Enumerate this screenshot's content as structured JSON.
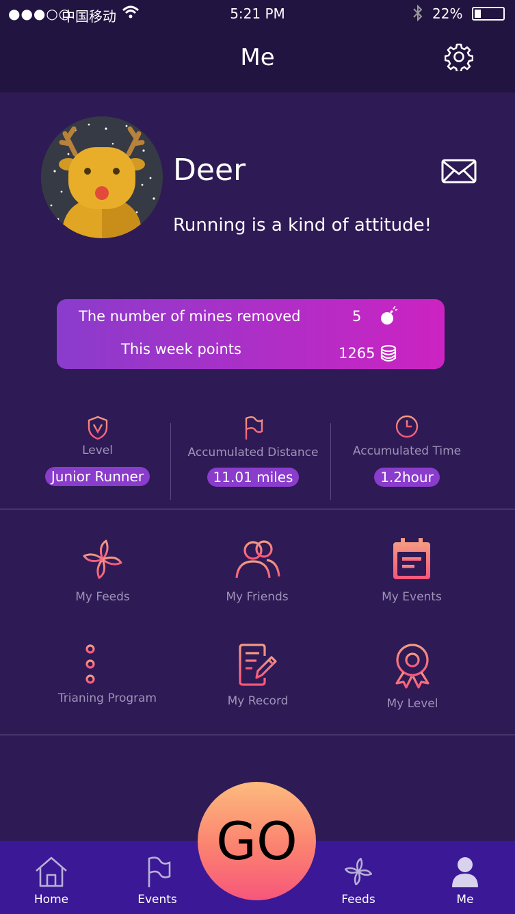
{
  "status_bar": {
    "signal": "●●●○○",
    "carrier": "中国移动",
    "time": "5:21 PM",
    "battery_percent": "22%",
    "battery_level": 0.22
  },
  "header": {
    "title": "Me"
  },
  "profile": {
    "name": "Deer",
    "motto": "Running is a kind of attitude!"
  },
  "stats_card": {
    "mines_label": "The number of mines removed",
    "mines_value": "5",
    "points_label": "This week points",
    "points_value": "1265"
  },
  "metrics": [
    {
      "label": "Level",
      "value": "Junior Runner",
      "icon": "shield-icon"
    },
    {
      "label": "Accumulated Distance",
      "value": "11.01 miles",
      "icon": "flag-icon"
    },
    {
      "label": "Accumulated Time",
      "value": "1.2hour",
      "icon": "clock-icon"
    }
  ],
  "grid": [
    {
      "label": "My Feeds",
      "icon": "pinwheel-icon"
    },
    {
      "label": "My Friends",
      "icon": "friends-icon"
    },
    {
      "label": "My Events",
      "icon": "calendar-icon"
    },
    {
      "label": "Trianing Program",
      "icon": "list-icon"
    },
    {
      "label": "My Record",
      "icon": "record-icon"
    },
    {
      "label": "My Level",
      "icon": "medal-icon"
    }
  ],
  "nav": {
    "home": "Home",
    "events": "Events",
    "go": "GO",
    "feeds": "Feeds",
    "me": "Me"
  },
  "colors": {
    "background": "#2e1a55",
    "accent_purple": "#8a3ccc",
    "accent_pink": "#cc23c2",
    "icon_gradient_start": "#f28a88",
    "icon_gradient_end": "#f7567b",
    "nav_bar": "#3b1896"
  }
}
